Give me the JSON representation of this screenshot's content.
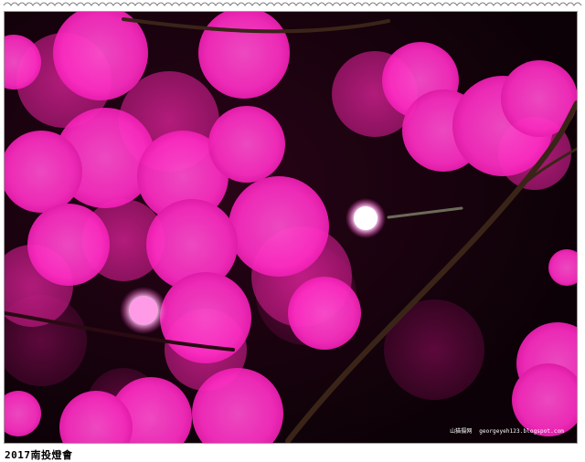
{
  "photo": {
    "subject": "pink bokeh lights",
    "dominant_color": "#ff2bc2",
    "background_color": "#0e0208"
  },
  "watermark": {
    "site_logo": "山猫摄网",
    "url": "georgeyeh123.blogspot.com"
  },
  "caption": {
    "text": "2017南投燈會"
  }
}
